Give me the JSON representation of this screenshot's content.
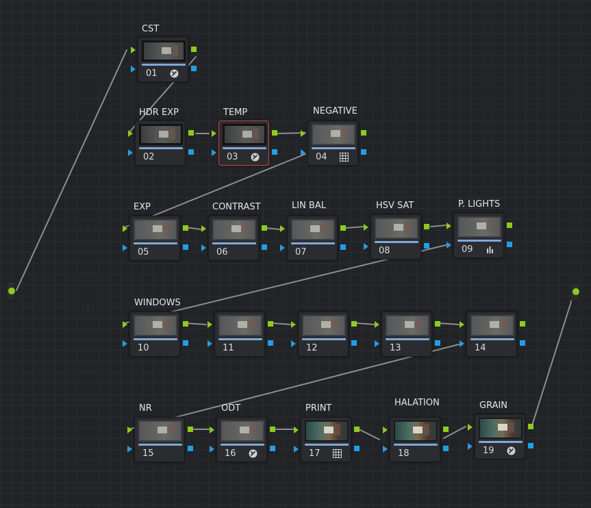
{
  "graph": {
    "nodes": [
      {
        "id": "01",
        "label": "CST",
        "badge": "effect-icon",
        "thumb": "dark",
        "selected": false
      },
      {
        "id": "02",
        "label": "HDR EXP",
        "badge": "",
        "thumb": "dark",
        "selected": false
      },
      {
        "id": "03",
        "label": "TEMP",
        "badge": "effect-icon",
        "thumb": "dark",
        "selected": true
      },
      {
        "id": "04",
        "label": "NEGATIVE",
        "badge": "grid-icon",
        "thumb": "grey",
        "selected": false
      },
      {
        "id": "05",
        "label": "EXP",
        "badge": "",
        "thumb": "grey",
        "selected": false
      },
      {
        "id": "06",
        "label": "CONTRAST",
        "badge": "",
        "thumb": "grey",
        "selected": false
      },
      {
        "id": "07",
        "label": "LIN BAL",
        "badge": "",
        "thumb": "grey",
        "selected": false
      },
      {
        "id": "08",
        "label": "HSV SAT",
        "badge": "",
        "thumb": "grey",
        "selected": false
      },
      {
        "id": "09",
        "label": "P. LIGHTS",
        "badge": "bars-icon",
        "thumb": "grey",
        "selected": false
      },
      {
        "id": "10",
        "label": "WINDOWS",
        "badge": "",
        "thumb": "grey",
        "selected": false
      },
      {
        "id": "11",
        "label": "",
        "badge": "",
        "thumb": "grey",
        "selected": false
      },
      {
        "id": "12",
        "label": "",
        "badge": "",
        "thumb": "grey",
        "selected": false
      },
      {
        "id": "13",
        "label": "",
        "badge": "",
        "thumb": "grey",
        "selected": false
      },
      {
        "id": "14",
        "label": "",
        "badge": "",
        "thumb": "grey",
        "selected": false
      },
      {
        "id": "15",
        "label": "NR",
        "badge": "",
        "thumb": "grey",
        "selected": false
      },
      {
        "id": "16",
        "label": "ODT",
        "badge": "effect-icon",
        "thumb": "grey",
        "selected": false
      },
      {
        "id": "17",
        "label": "PRINT",
        "badge": "grid-icon",
        "thumb": "color",
        "selected": false
      },
      {
        "id": "18",
        "label": "HALATION",
        "badge": "",
        "thumb": "color",
        "selected": false
      },
      {
        "id": "19",
        "label": "GRAIN",
        "badge": "effect-icon",
        "thumb": "color",
        "selected": false
      }
    ],
    "colors": {
      "rgb_port": "#8ccc1c",
      "alpha_port": "#1fa0e6",
      "wire": "#8e8e8e",
      "selected_border": "#c94a3c",
      "node_bar": "#7fa9d8"
    }
  }
}
